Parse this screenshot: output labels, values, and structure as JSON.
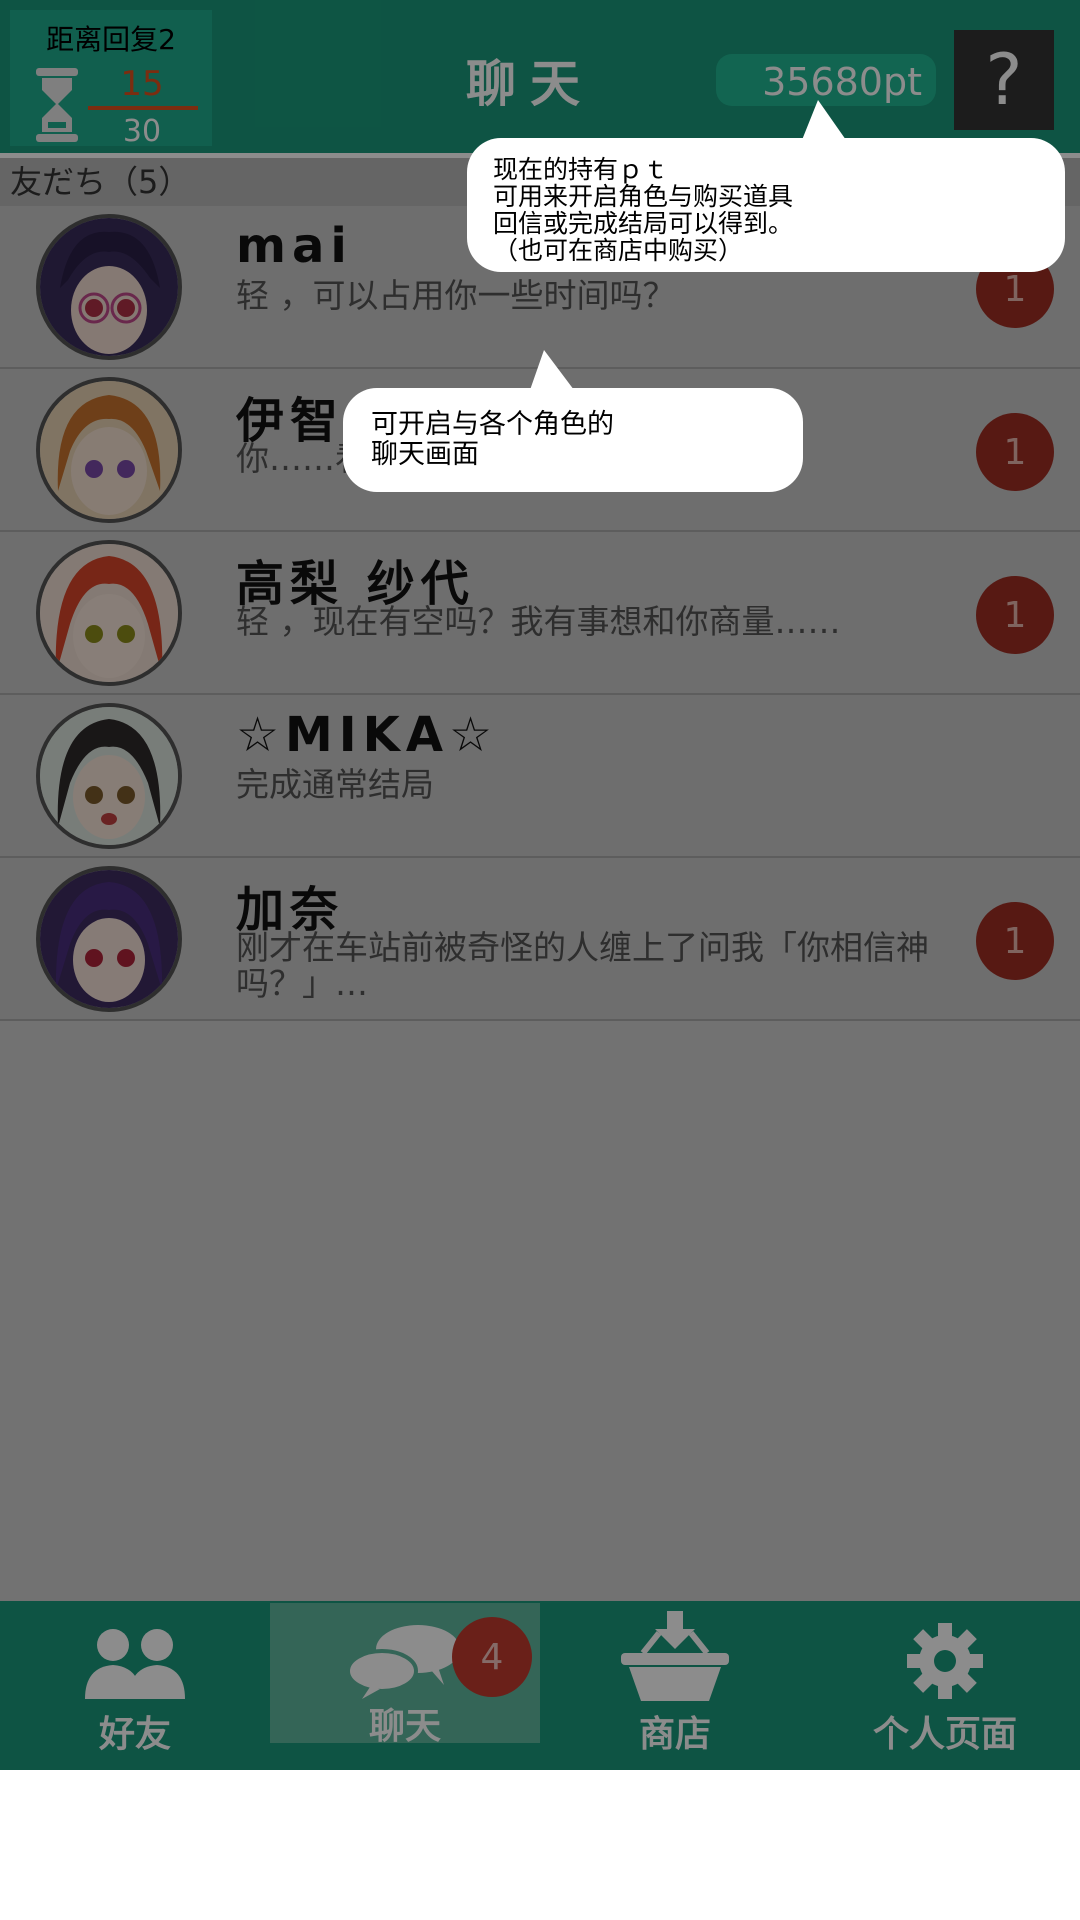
{
  "header": {
    "timer_label": "距离回复2",
    "timer_current": "15",
    "timer_max": "30",
    "title": "聊天",
    "points": "35680pt",
    "help_label": "?"
  },
  "friends": {
    "section_label": "友だち（5）",
    "rows": [
      {
        "name": "mai",
        "message": "轻 ，可以占用你一些时间吗？",
        "badge": "1"
      },
      {
        "name": "伊智",
        "message": "你……看 情请一定保密…(´ω`;)",
        "badge": "1"
      },
      {
        "name": "高梨 纱代",
        "message": "轻 ，现在有空吗？我有事想和你商量……",
        "badge": "1"
      },
      {
        "name": "☆MIKA☆",
        "message": "完成通常结局",
        "badge": ""
      },
      {
        "name": "加奈",
        "message": "刚才在车站前被奇怪的人缠上了问我「你相信神吗？」…",
        "badge": "1"
      }
    ]
  },
  "tabs": [
    {
      "label": "好友"
    },
    {
      "label": "聊天"
    },
    {
      "label": "商店"
    },
    {
      "label": "个人页面"
    }
  ],
  "tab_badge": "4",
  "tooltips": {
    "points": [
      "现在的持有ｐｔ",
      "可用来开启角色与购买道具",
      "回信或完成结局可以得到。",
      "（也可在商店中购买）"
    ],
    "chat": [
      "可开启与各个角色的",
      "聊天画面"
    ]
  },
  "colors": {
    "primary": "#1a9a7c",
    "badge": "#c23b2f",
    "timer_accent": "#e0531e"
  }
}
